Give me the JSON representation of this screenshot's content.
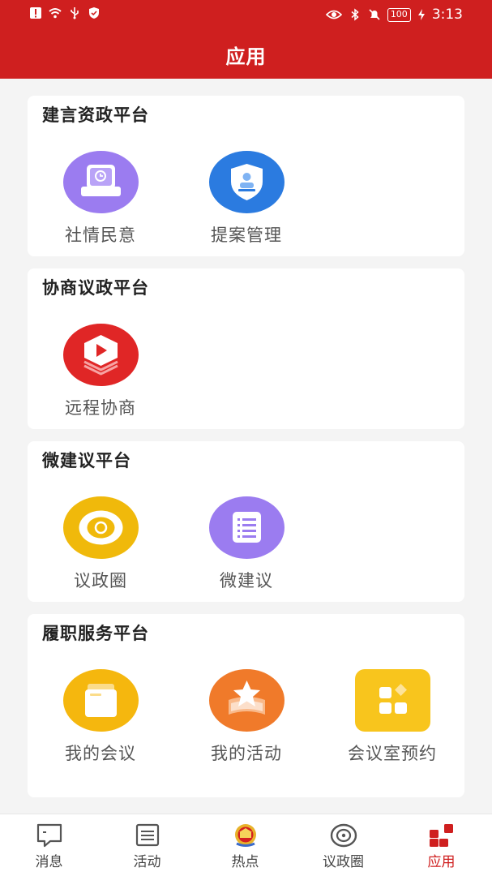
{
  "status_bar": {
    "time": "3:13",
    "battery": "100"
  },
  "header": {
    "title": "应用"
  },
  "sections": [
    {
      "title": "建言资政平台",
      "apps": [
        {
          "label": "社情民意",
          "icon": "survey-icon",
          "color": "#9b7cf0"
        },
        {
          "label": "提案管理",
          "icon": "shield-icon",
          "color": "#2b7be0"
        }
      ]
    },
    {
      "title": "协商议政平台",
      "apps": [
        {
          "label": "远程协商",
          "icon": "video-icon",
          "color": "#e02626"
        }
      ]
    },
    {
      "title": "微建议平台",
      "apps": [
        {
          "label": "议政圈",
          "icon": "circle-icon",
          "color": "#f0b90b"
        },
        {
          "label": "微建议",
          "icon": "list-icon",
          "color": "#9b7cf0"
        }
      ]
    },
    {
      "title": "履职服务平台",
      "apps": [
        {
          "label": "我的会议",
          "icon": "folder-icon",
          "color": "#f5b70e"
        },
        {
          "label": "我的活动",
          "icon": "star-icon",
          "color": "#f07a2a"
        },
        {
          "label": "会议室预约",
          "icon": "grid-icon",
          "color": "#f8c51d"
        }
      ]
    }
  ],
  "tabs": [
    {
      "label": "消息",
      "icon": "message-icon"
    },
    {
      "label": "活动",
      "icon": "activity-icon"
    },
    {
      "label": "热点",
      "icon": "emblem-icon"
    },
    {
      "label": "议政圈",
      "icon": "circle-icon"
    },
    {
      "label": "应用",
      "icon": "apps-icon",
      "active": true
    }
  ]
}
